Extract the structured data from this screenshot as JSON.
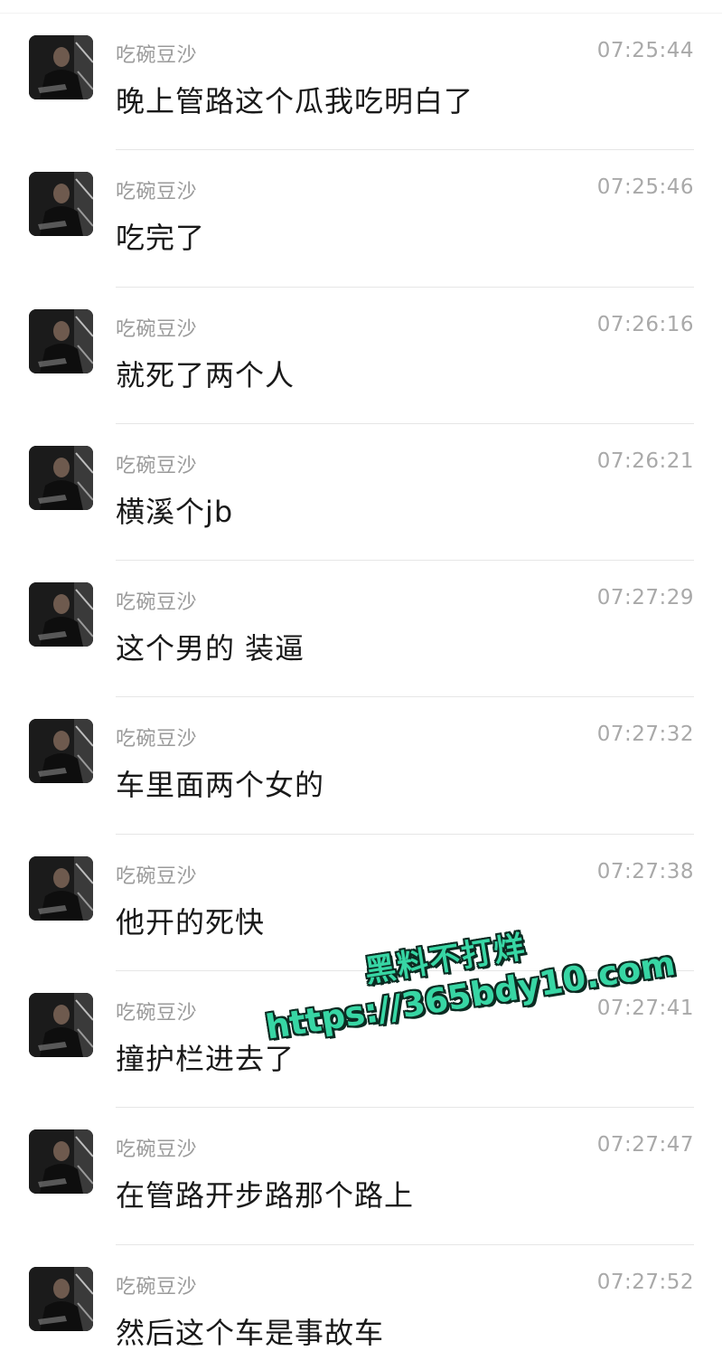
{
  "messages": [
    {
      "sender": "吃碗豆沙",
      "time": "07:25:44",
      "text": "晚上管路这个瓜我吃明白了"
    },
    {
      "sender": "吃碗豆沙",
      "time": "07:25:46",
      "text": "吃完了"
    },
    {
      "sender": "吃碗豆沙",
      "time": "07:26:16",
      "text": "就死了两个人"
    },
    {
      "sender": "吃碗豆沙",
      "time": "07:26:21",
      "text": "横溪个jb"
    },
    {
      "sender": "吃碗豆沙",
      "time": "07:27:29",
      "text": "这个男的 装逼"
    },
    {
      "sender": "吃碗豆沙",
      "time": "07:27:32",
      "text": "车里面两个女的"
    },
    {
      "sender": "吃碗豆沙",
      "time": "07:27:38",
      "text": "他开的死快"
    },
    {
      "sender": "吃碗豆沙",
      "time": "07:27:41",
      "text": "撞护栏进去了"
    },
    {
      "sender": "吃碗豆沙",
      "time": "07:27:47",
      "text": "在管路开步路那个路上"
    },
    {
      "sender": "吃碗豆沙",
      "time": "07:27:52",
      "text": "然后这个车是事故车"
    }
  ],
  "watermark": {
    "line1": "黑料不打烊",
    "line2": "https://365bdy10.com",
    "color": "#37d6a4"
  },
  "colors": {
    "background": "#ffffff",
    "sender": "#9a9a9a",
    "time": "#a9a9a9",
    "text": "#191919",
    "divider": "#e6e6e6"
  }
}
